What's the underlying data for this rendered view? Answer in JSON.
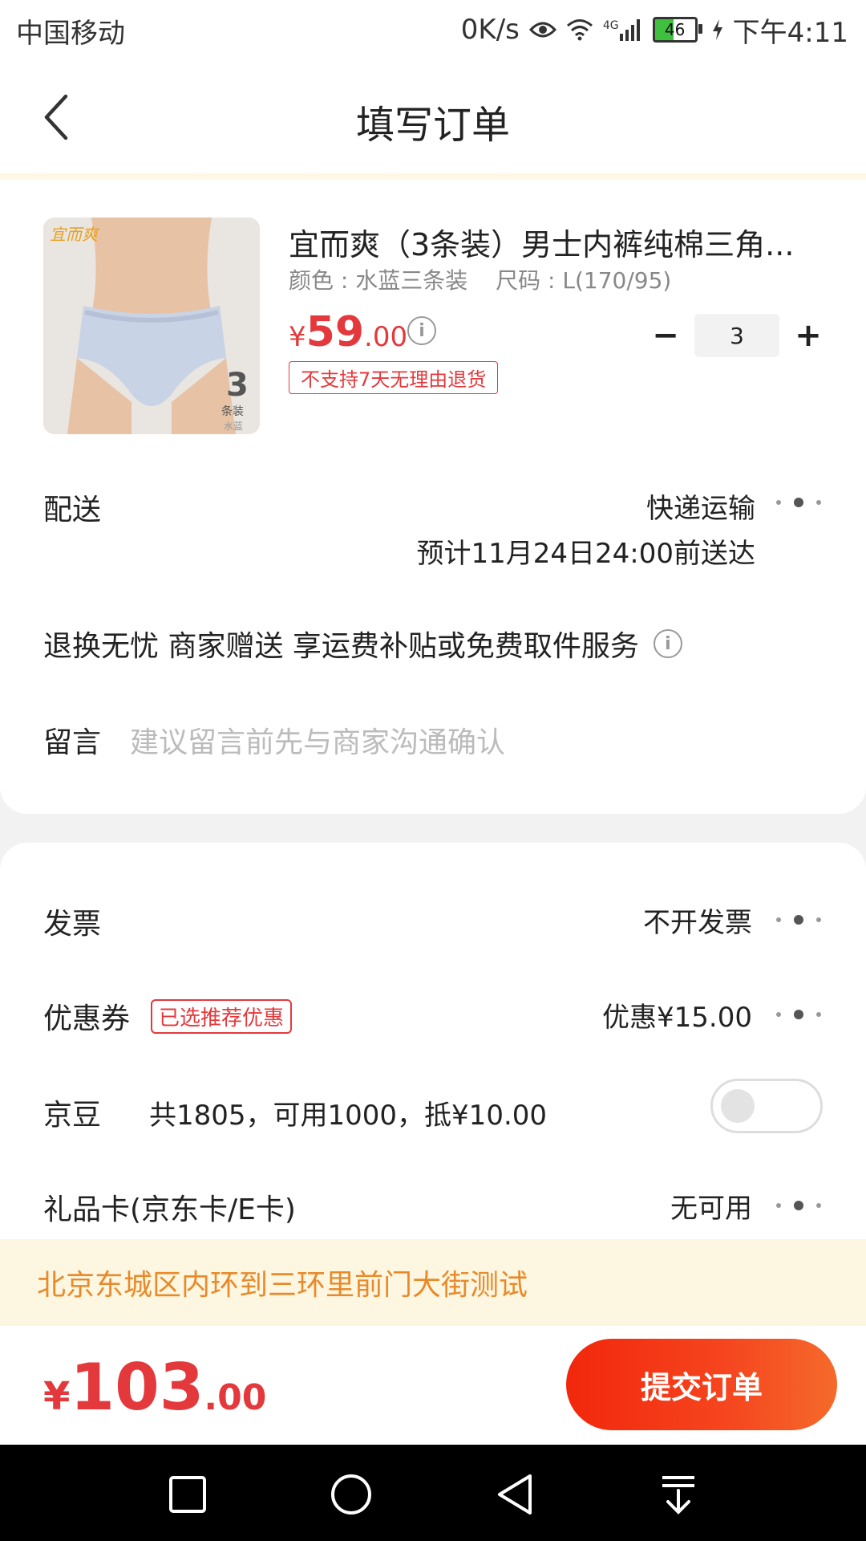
{
  "status_bar": {
    "carrier": "中国移动",
    "net_speed": "0K/s",
    "network_type": "4G",
    "battery": "46",
    "time": "下午4:11"
  },
  "header": {
    "title": "填写订单"
  },
  "product": {
    "title": "宜而爽（3条装）男士内裤纯棉三角...",
    "color_spec": "颜色 : 水蓝三条装",
    "size_spec": "尺码 : L(170/95)",
    "price_currency": "¥",
    "price_int": "59",
    "price_dec": ".00",
    "return_tag": "不支持7天无理由退货",
    "quantity": "3",
    "minus": "−",
    "plus": "+",
    "image_brand": "宜而爽",
    "image_count": "3",
    "image_pack": "条装",
    "image_color": "水蓝"
  },
  "delivery": {
    "label": "配送",
    "method": "快递运输",
    "eta": "预计11月24日24:00前送达"
  },
  "return_service": {
    "text": "退换无忧 商家赠送  享运费补贴或免费取件服务"
  },
  "message": {
    "label": "留言",
    "placeholder": "建议留言前先与商家沟通确认"
  },
  "invoice": {
    "label": "发票",
    "value": "不开发票"
  },
  "coupon": {
    "label": "优惠券",
    "tag": "已选推荐优惠",
    "value": "优惠¥15.00"
  },
  "jingdou": {
    "label": "京豆",
    "desc": "共1805，可用1000，抵¥10.00",
    "enabled": false
  },
  "gift_card": {
    "label": "礼品卡(京东卡/E卡)",
    "value": "无可用"
  },
  "address": {
    "text": "北京东城区内环到三环里前门大街测试"
  },
  "footer": {
    "total_currency": "¥",
    "total_int": "103",
    "total_dec": ".00",
    "submit_label": "提交订单"
  },
  "colors": {
    "accent_red": "#e4393c",
    "address_orange": "#e88a2a",
    "address_bg": "#fdf6e0"
  }
}
